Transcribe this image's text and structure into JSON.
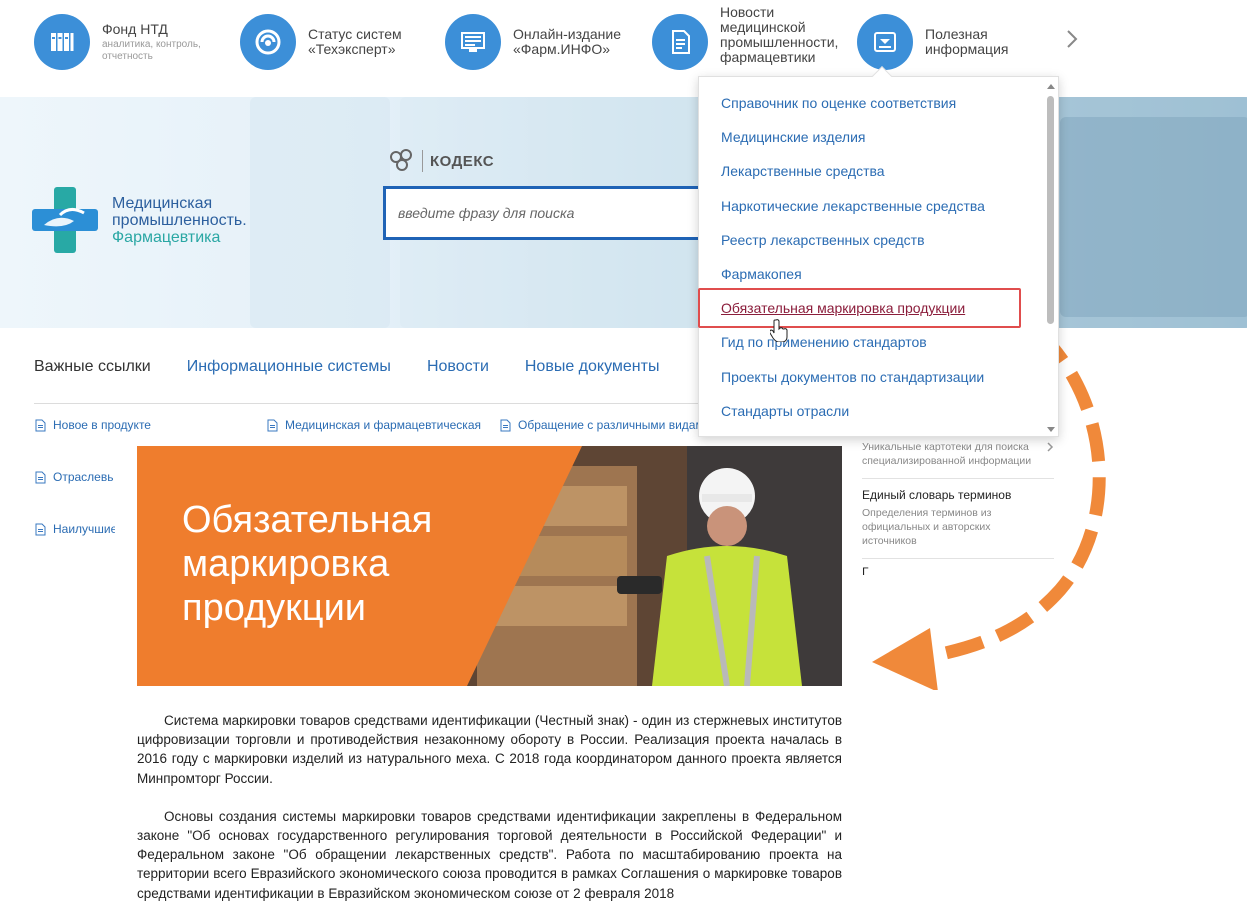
{
  "services": [
    {
      "title": "Фонд НТД",
      "subtitle": "аналитика, контроль, отчетность",
      "icon": "folders-icon"
    },
    {
      "title": "Статус систем «Техэксперт»",
      "subtitle": "",
      "icon": "status-icon"
    },
    {
      "title": "Онлайн-издание «Фарм.ИНФО»",
      "subtitle": "",
      "icon": "monitor-icon"
    },
    {
      "title": "Новости медицинской промышленности, фармацевтики",
      "subtitle": "",
      "icon": "document-icon"
    },
    {
      "title": "Полезная информация",
      "subtitle": "",
      "icon": "info-card-icon"
    }
  ],
  "brand": {
    "line1": "Медицинская",
    "line2": "промышленность.",
    "line3": "Фармацевтика"
  },
  "kodeks": {
    "name": "КОДЕКС"
  },
  "search": {
    "placeholder": "введите фразу для поиска"
  },
  "tabs": [
    {
      "label": "Важные ссылки",
      "active": true
    },
    {
      "label": "Информационные системы",
      "active": false
    },
    {
      "label": "Новости",
      "active": false
    },
    {
      "label": "Новые документы",
      "active": false
    }
  ],
  "links": {
    "new_in_product": "Новое в продукте",
    "med_pharma": "Медицинская и фармацевтическая",
    "appeal": "Обращение с различными видами",
    "industry": "Отраслевь",
    "best": "Наилучшие"
  },
  "banner": {
    "line1": "Обязательная",
    "line2": "маркировка",
    "line3": "продукции"
  },
  "article": {
    "p1": "Система маркировки товаров средствами идентификации (Честный знак) - один из стержневых институтов цифровизации торговли и противодействия незаконному обороту в России. Реализация проекта началась в 2016 году с маркировки изделий из натурального меха. С 2018 года координатором данного проекта является Минпромторг России.",
    "p2": "Основы создания системы маркировки товаров средствами идентификации закреплены в Федеральном законе \"Об основах государственного регулирования торговой деятельности в Российской Федерации\" и Федеральном законе \"Об обращении лекарственных средств\". Работа по масштабированию проекта на территории всего Евразийского экономического союза проводится в рамках Соглашения о маркировке товаров средствами идентификации в Евразийском экономическом союзе от 2 февраля 2018"
  },
  "sidebar": {
    "item1_desc": "Уникальные картотеки для поиска специализированной информации",
    "item2_title": "Единый словарь терминов",
    "item2_desc": "Определения терминов из официальных и авторских источников",
    "item3_title": "Г"
  },
  "dropdown": {
    "items": [
      "Справочник по оценке соответствия",
      "Медицинские изделия",
      "Лекарственные средства",
      "Наркотические лекарственные средства",
      "Реестр лекарственных средств",
      "Фармакопея",
      "Обязательная маркировка продукции",
      "Гид по применению стандартов",
      "Проекты документов по стандартизации",
      "Стандарты отрасли"
    ],
    "hovered_index": 6
  },
  "colors": {
    "accent": "#3c8fd8",
    "link": "#2b6cb3",
    "search_border": "#1f63b6",
    "banner_orange": "#ef7d2d",
    "highlight_red": "#e04d4d",
    "arrow_orange": "#f0893a"
  }
}
